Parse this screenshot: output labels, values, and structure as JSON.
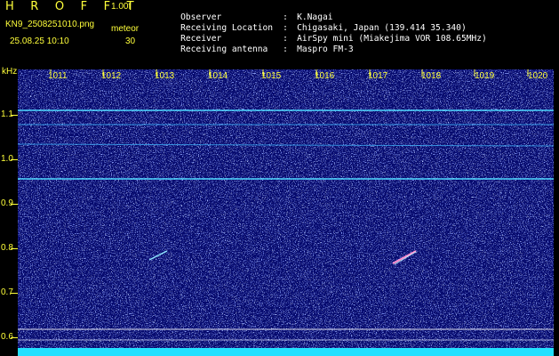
{
  "header": {
    "app_title": "H R O F F T",
    "version": "1.00f",
    "filename": "KN9_2508251010.png",
    "meteor_label": "meteor",
    "datetime": "25.08.25 10:10",
    "meteor_count": "30"
  },
  "info": [
    {
      "key": "Observer",
      "value": "K.Nagai"
    },
    {
      "key": "Receiving Location",
      "value": "Chigasaki, Japan (139.414 35.340)"
    },
    {
      "key": "Receiver",
      "value": "AirSpy mini (Miakejima VOR 108.65MHz)"
    },
    {
      "key": "Receiving antenna",
      "value": "Maspro FM-3"
    }
  ],
  "axis": {
    "y_unit": "kHz",
    "y_ticks": [
      "1.1",
      "1.0",
      "0.9",
      "0.8",
      "0.7",
      "0.6"
    ],
    "x_ticks": [
      "1011",
      "1012",
      "1013",
      "1014",
      "1015",
      "1016",
      "1017",
      "1018",
      "1019",
      "1020"
    ]
  },
  "colors": {
    "label": "#ffff3a",
    "background": "#060a6e",
    "trace": "#4fd8ff",
    "bottom_band": "#23e0ff"
  }
}
